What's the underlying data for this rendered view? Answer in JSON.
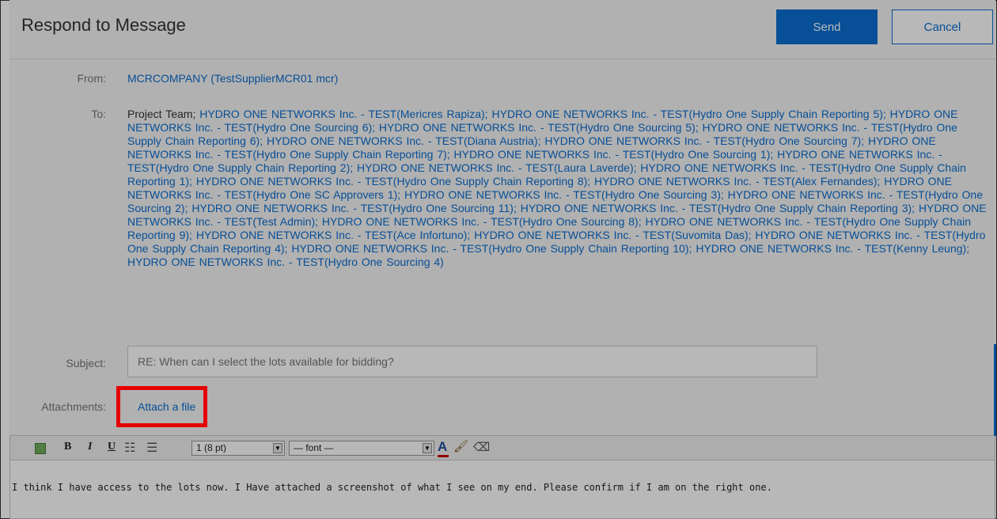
{
  "dialog": {
    "title": "Respond to Message",
    "send_label": "Send",
    "cancel_label": "Cancel"
  },
  "from": {
    "label": "From:",
    "value": "MCRCOMPANY  (TestSupplierMCR01 mcr)"
  },
  "to": {
    "label": "To:",
    "first": "Project Team;",
    "recipients": "HYDRO ONE NETWORKS Inc. - TEST(Mericres Rapiza);  HYDRO ONE NETWORKS Inc. - TEST(Hydro One Supply Chain Reporting 5);  HYDRO ONE NETWORKS Inc. - TEST(Hydro One Sourcing 6);  HYDRO ONE NETWORKS Inc. - TEST(Hydro One Sourcing 5);  HYDRO ONE NETWORKS Inc. - TEST(Hydro One Supply Chain Reporting 6);  HYDRO ONE NETWORKS Inc. - TEST(Diana Austria);  HYDRO ONE NETWORKS Inc. - TEST(Hydro One Sourcing 7);  HYDRO ONE NETWORKS Inc. - TEST(Hydro One Supply Chain Reporting 7);  HYDRO ONE NETWORKS Inc. - TEST(Hydro One Sourcing 1);  HYDRO ONE NETWORKS Inc. - TEST(Hydro One Supply Chain Reporting 2);  HYDRO ONE NETWORKS Inc. - TEST(Laura Laverde);  HYDRO ONE NETWORKS Inc. - TEST(Hydro One Supply Chain Reporting 1);  HYDRO ONE NETWORKS Inc. - TEST(Hydro One Supply Chain Reporting 8);  HYDRO ONE NETWORKS Inc. - TEST(Alex Fernandes);  HYDRO ONE NETWORKS Inc. - TEST(Hydro One SC Approvers 1);  HYDRO ONE NETWORKS Inc. - TEST(Hydro One Sourcing 3);  HYDRO ONE NETWORKS Inc. - TEST(Hydro One Sourcing 2);  HYDRO ONE NETWORKS Inc. - TEST(Hydro One Sourcing 11);  HYDRO ONE NETWORKS Inc. - TEST(Hydro One Supply Chain Reporting 3);  HYDRO ONE NETWORKS Inc. - TEST(Test Admin);  HYDRO ONE NETWORKS Inc. - TEST(Hydro One Sourcing 8);  HYDRO ONE NETWORKS Inc. - TEST(Hydro One Supply Chain Reporting 9);  HYDRO ONE NETWORKS Inc. - TEST(Ace Infortuno);  HYDRO ONE NETWORKS Inc. - TEST(Suvomita Das);  HYDRO ONE NETWORKS Inc. - TEST(Hydro One Supply Chain Reporting 4);  HYDRO ONE NETWORKS Inc. - TEST(Hydro One Supply Chain Reporting 10);  HYDRO ONE NETWORKS Inc. - TEST(Kenny Leung);  HYDRO ONE NETWORKS Inc. - TEST(Hydro One Sourcing 4)"
  },
  "subject": {
    "label": "Subject:",
    "value": "RE: When can I select the lots available for bidding?"
  },
  "attachments": {
    "label": "Attachments:",
    "link": "Attach a file"
  },
  "editor": {
    "toolbar": {
      "bold": "B",
      "italic": "I",
      "underline": "U",
      "ordered_list": "☷",
      "unordered_list": "☰",
      "size": "1 (8 pt)",
      "font": "— font —",
      "text_color": "A",
      "highlight_color": "🖌",
      "eraser": "⌫"
    },
    "body": "I think I have access to the lots now. I Have attached a screenshot of what I see on my end. Please confirm if I am on the right one."
  },
  "colors": {
    "accent": "#0a6ed1",
    "highlight_box": "#e60000"
  }
}
